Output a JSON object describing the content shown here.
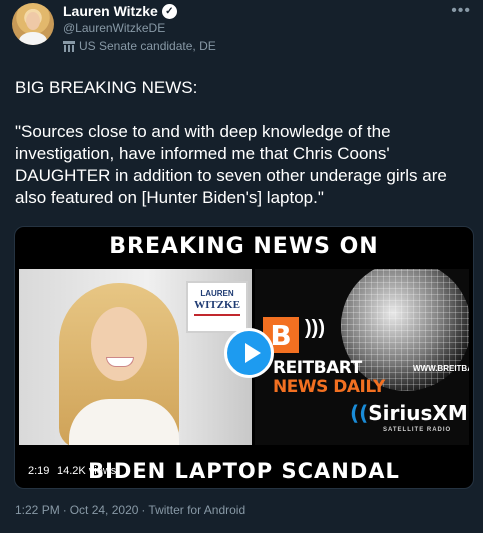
{
  "author": {
    "name": "Lauren Witzke",
    "handle": "@LaurenWitzkeDE",
    "label": "US Senate candidate, DE",
    "verified_icon": "checkmark-badge-icon",
    "label_icon": "government-building-icon"
  },
  "more_icon": "more-dots-icon",
  "tweet": {
    "line1": "BIG BREAKING NEWS:",
    "paragraph": "\"Sources close to and with deep knowledge of the investigation, have informed me that Chris Coons' DAUGHTER in addition to seven other underage girls are also featured on [Hunter Biden's] laptop.\""
  },
  "media": {
    "banner_top": "BREAKING NEWS ON",
    "banner_bottom": "BIDEN LAPTOP SCANDAL",
    "sign_line1": "LAUREN",
    "sign_line2": "WITZKE",
    "brand_logo_letter": "B",
    "brand_line1": "REITBART",
    "brand_line2": "NEWS DAILY",
    "site_url": "WWW.BREITBART.COM",
    "radio_logo": "SiriusXM",
    "radio_sub": "SATELLITE RADIO",
    "duration": "2:19",
    "views": "14.2K views",
    "play_icon": "play-icon"
  },
  "meta": {
    "time": "1:22 PM",
    "date": "Oct 24, 2020",
    "client": "Twitter for Android"
  },
  "colors": {
    "background": "#15202b",
    "secondary_text": "#8899a6",
    "accent": "#1d9bf0",
    "breitbart_orange": "#f37021"
  }
}
